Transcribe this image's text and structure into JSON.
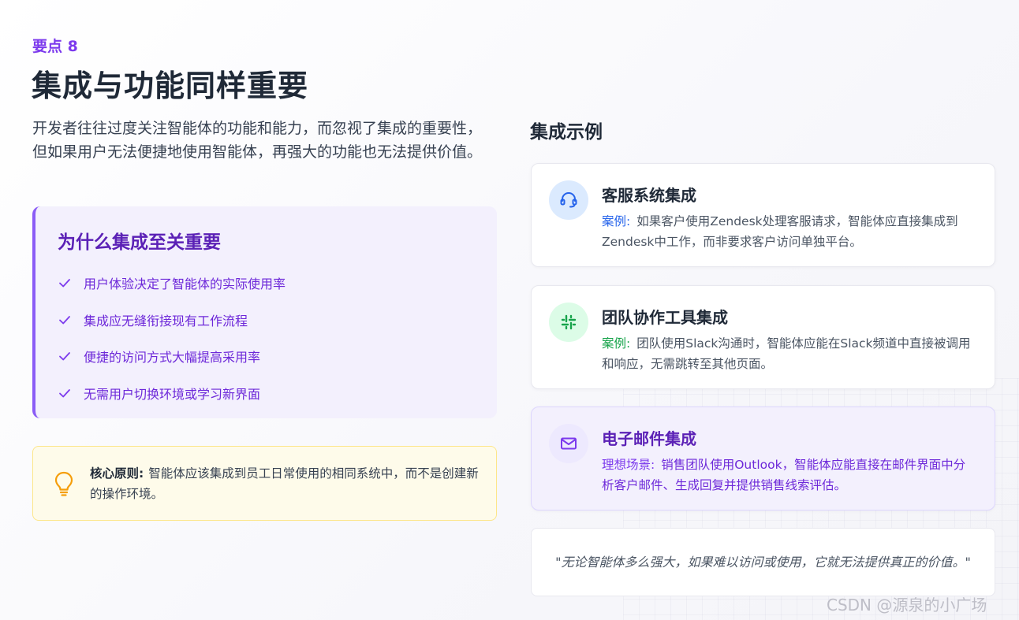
{
  "header": {
    "eyebrow": "要点 8",
    "title": "集成与功能同样重要",
    "intro": "开发者往往过度关注智能体的功能和能力，而忽视了集成的重要性，但如果用户无法便捷地使用智能体，再强大的功能也无法提供价值。"
  },
  "why": {
    "title": "为什么集成至关重要",
    "items": [
      {
        "text": "用户体验决定了智能体的实际使用率",
        "icon": "check-icon"
      },
      {
        "text": "集成应无缝衔接现有工作流程",
        "icon": "check-icon"
      },
      {
        "text": "便捷的访问方式大幅提高采用率",
        "icon": "check-icon"
      },
      {
        "text": "无需用户切换环境或学习新界面",
        "icon": "check-icon"
      }
    ]
  },
  "principle": {
    "icon": "lightbulb-icon",
    "label": "核心原则:",
    "text": "智能体应该集成到员工日常使用的相同系统中，而不是创建新的操作环境。"
  },
  "examples": {
    "title": "集成示例",
    "cards": [
      {
        "icon": "headset-icon",
        "icon_color": "#2563eb",
        "icon_bg": "#dbeafe",
        "title": "客服系统集成",
        "label": "案例:",
        "label_color": "#2563eb",
        "text": "如果客户使用Zendesk处理客服请求，智能体应直接集成到Zendesk中工作，而非要求客户访问单独平台。"
      },
      {
        "icon": "slack-icon",
        "icon_color": "#16a34a",
        "icon_bg": "#dcfce7",
        "title": "团队协作工具集成",
        "label": "案例:",
        "label_color": "#16a34a",
        "text": "团队使用Slack沟通时，智能体应能在Slack频道中直接被调用和响应，无需跳转至其他页面。"
      },
      {
        "icon": "mail-icon",
        "icon_color": "#7c3aed",
        "icon_bg": "#ede9fe",
        "title": "电子邮件集成",
        "label": "理想场景:",
        "label_color": "#7c3aed",
        "text": "销售团队使用Outlook，智能体应能直接在邮件界面中分析客户邮件、生成回复并提供销售线索评估。"
      }
    ]
  },
  "quote": "\"无论智能体多么强大，如果难以访问或使用，它就无法提供真正的价值。\"",
  "watermark": "CSDN @源泉的小广场",
  "colors": {
    "accent": "#7c3aed",
    "accent_dark": "#5b21b6",
    "principle_bg": "#fefbea",
    "bulb": "#f59e0b"
  }
}
